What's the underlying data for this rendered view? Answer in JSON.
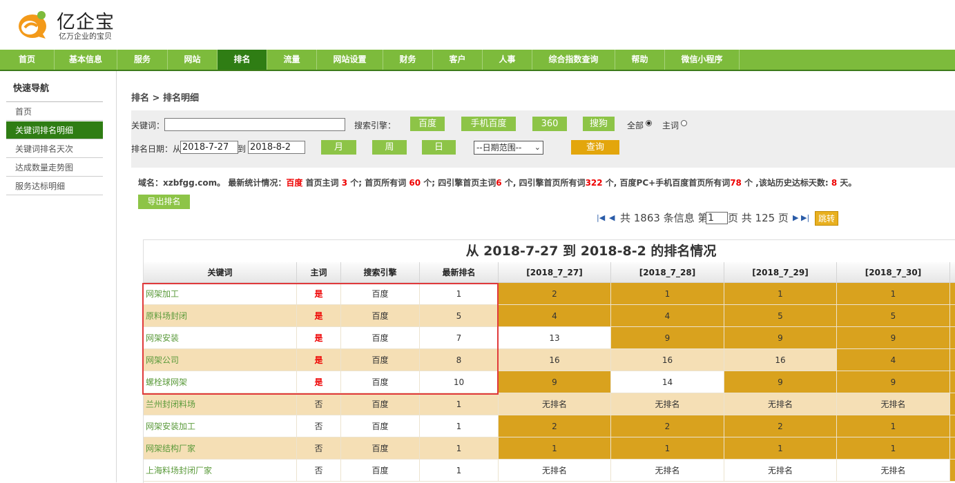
{
  "logo": {
    "title": "亿企宝",
    "subtitle": "亿万企业的宝贝"
  },
  "nav": [
    "首页",
    "基本信息",
    "服务",
    "网站",
    "排名",
    "流量",
    "网站设置",
    "财务",
    "客户",
    "人事",
    "综合指数查询",
    "帮助",
    "微信小程序"
  ],
  "nav_active": "排名",
  "sidebar": {
    "title": "快速导航",
    "items": [
      "首页",
      "关键词排名明细",
      "关键词排名天次",
      "达成数量走势图",
      "服务达标明细"
    ],
    "active": "关键词排名明细"
  },
  "breadcrumb": "排名 > 排名明细",
  "filter": {
    "keyword_label": "关键词：",
    "keyword_value": "",
    "engine_label": "搜索引擎：",
    "engines": [
      "百度",
      "手机百度",
      "360",
      "搜狗"
    ],
    "radio_all": "全部",
    "radio_main": "主词",
    "date_label": "排名日期：从",
    "date_from": "2018-7-27",
    "date_to_label": "到",
    "date_to": "2018-8-2",
    "periods": [
      "月",
      "周",
      "日"
    ],
    "range_select": "--日期范围--",
    "query_button": "查询"
  },
  "stats": {
    "domain_label": "域名：",
    "domain": "xzbfgg.com",
    "sep": "。 最新统计情况：",
    "engine": "百度",
    "t1": " 首页主词 ",
    "v1": "3",
    "t2": " 个; 首页所有词 ",
    "v2": "60",
    "t3": " 个; 四引擎首页主词",
    "v3": "6",
    "t4": " 个, 四引擎首页所有词",
    "v4": "322",
    "t5": " 个, 百度PC+手机百度首页所有词",
    "v5": "78",
    "t6": " 个 ,该站历史达标天数: ",
    "v6": "8",
    "t7": " 天。"
  },
  "export_button": "导出排名",
  "pager": {
    "total_text": "共 1863 条信息 第",
    "page": "1",
    "pages_text": "页 共 125 页",
    "jump": "跳转"
  },
  "table": {
    "title": "从 2018-7-27 到 2018-8-2 的排名情况",
    "headers": [
      "关键词",
      "主词",
      "搜索引擎",
      "最新排名",
      "[2018_7_27]",
      "[2018_7_28]",
      "[2018_7_29]",
      "[2018_7_30]"
    ],
    "rows": [
      {
        "kw": "网架加工",
        "main": "是",
        "engine": "百度",
        "latest": "1",
        "days": [
          "2",
          "1",
          "1",
          "1"
        ]
      },
      {
        "kw": "原料场封闭",
        "main": "是",
        "engine": "百度",
        "latest": "5",
        "days": [
          "4",
          "4",
          "5",
          "5"
        ]
      },
      {
        "kw": "网架安装",
        "main": "是",
        "engine": "百度",
        "latest": "7",
        "days": [
          "13",
          "9",
          "9",
          "9"
        ]
      },
      {
        "kw": "网架公司",
        "main": "是",
        "engine": "百度",
        "latest": "8",
        "days": [
          "16",
          "16",
          "16",
          "4"
        ]
      },
      {
        "kw": "螺栓球网架",
        "main": "是",
        "engine": "百度",
        "latest": "10",
        "days": [
          "9",
          "14",
          "9",
          "9"
        ]
      },
      {
        "kw": "兰州封闭料场",
        "main": "否",
        "engine": "百度",
        "latest": "1",
        "days": [
          "无排名",
          "无排名",
          "无排名",
          "无排名"
        ]
      },
      {
        "kw": "网架安装加工",
        "main": "否",
        "engine": "百度",
        "latest": "1",
        "days": [
          "2",
          "2",
          "2",
          "1"
        ]
      },
      {
        "kw": "网架结构厂家",
        "main": "否",
        "engine": "百度",
        "latest": "1",
        "days": [
          "1",
          "1",
          "1",
          "1"
        ]
      },
      {
        "kw": "上海料场封闭厂家",
        "main": "否",
        "engine": "百度",
        "latest": "1",
        "days": [
          "无排名",
          "无排名",
          "无排名",
          "无排名"
        ]
      }
    ]
  },
  "colors": {
    "nav_green": "#7dbb3c",
    "nav_active": "#2f7d14",
    "gold": "#d9a21e",
    "beige": "#f5dfb5",
    "white": "#ffffff",
    "red": "#e00000"
  }
}
